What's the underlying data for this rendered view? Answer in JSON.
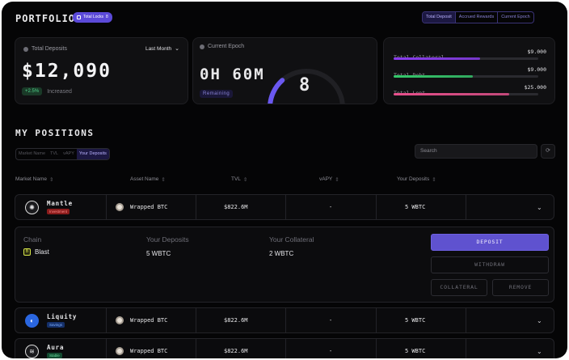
{
  "header": {
    "title": "PORTFOLIO",
    "badge_label": "Total Locks",
    "badge_count": "8",
    "segments": [
      "Total Deposit",
      "Accrued Rewards",
      "Current Epoch"
    ]
  },
  "deposits_card": {
    "label": "Total Deposits",
    "period": "Last Month",
    "amount": "$12,090",
    "change": "+2.5%",
    "change_text": "Increased"
  },
  "epoch_card": {
    "label": "Current Epoch",
    "time": "0H 60M",
    "status": "Remaining",
    "epoch_number": "8",
    "progress": 0.27
  },
  "totals_card": {
    "items": [
      {
        "label": "Total Collateral",
        "value": "$9.000",
        "color": "#8a3cf0",
        "progress": 0.6
      },
      {
        "label": "Total Debt",
        "value": "$9.000",
        "color": "#34c96b",
        "progress": 0.55
      },
      {
        "label": "Total Lent",
        "value": "$25.000",
        "color": "#e8508c",
        "progress": 0.8
      }
    ]
  },
  "positions": {
    "title": "MY POSITIONS",
    "filters": [
      "Market Name",
      "TVL",
      "vAPY",
      "Your Deposits"
    ],
    "search_placeholder": "Search",
    "columns": [
      "Market Name",
      "Asset Name",
      "TVL",
      "vAPY",
      "Your Deposits"
    ],
    "rows": [
      {
        "market": "Mantle",
        "tag": "Investment",
        "tag_color": "#8a1c1c",
        "tag_text": "#ff8a8a",
        "logo_bg": "#1a1a1d",
        "asset": "Wrapped BTC",
        "tvl": "$822.6M",
        "vapy": "-",
        "deposits": "5 WBTC"
      },
      {
        "market": "Liquity",
        "tag": "Savings",
        "tag_color": "#15306a",
        "tag_text": "#7fb0ff",
        "logo_bg": "#2a66e0",
        "asset": "Wrapped BTC",
        "tvl": "$822.6M",
        "vapy": "-",
        "deposits": "5 WBTC"
      },
      {
        "market": "Aura",
        "tag": "Stable",
        "tag_color": "#134a30",
        "tag_text": "#6ee3a4",
        "logo_bg": "#1a1a1d",
        "asset": "Wrapped BTC",
        "tvl": "$822.6M",
        "vapy": "-",
        "deposits": "5 WBTC"
      }
    ],
    "expanded": {
      "chain_label": "Chain",
      "chain_value": "Blast",
      "deposits_label": "Your Deposits",
      "deposits_value": "5 WBTC",
      "collateral_label": "Your Collateral",
      "collateral_value": "2 WBTC",
      "buttons": [
        "DEPOSIT",
        "WITHDRAW",
        "COLLATERAL",
        "REMOVE"
      ]
    }
  }
}
